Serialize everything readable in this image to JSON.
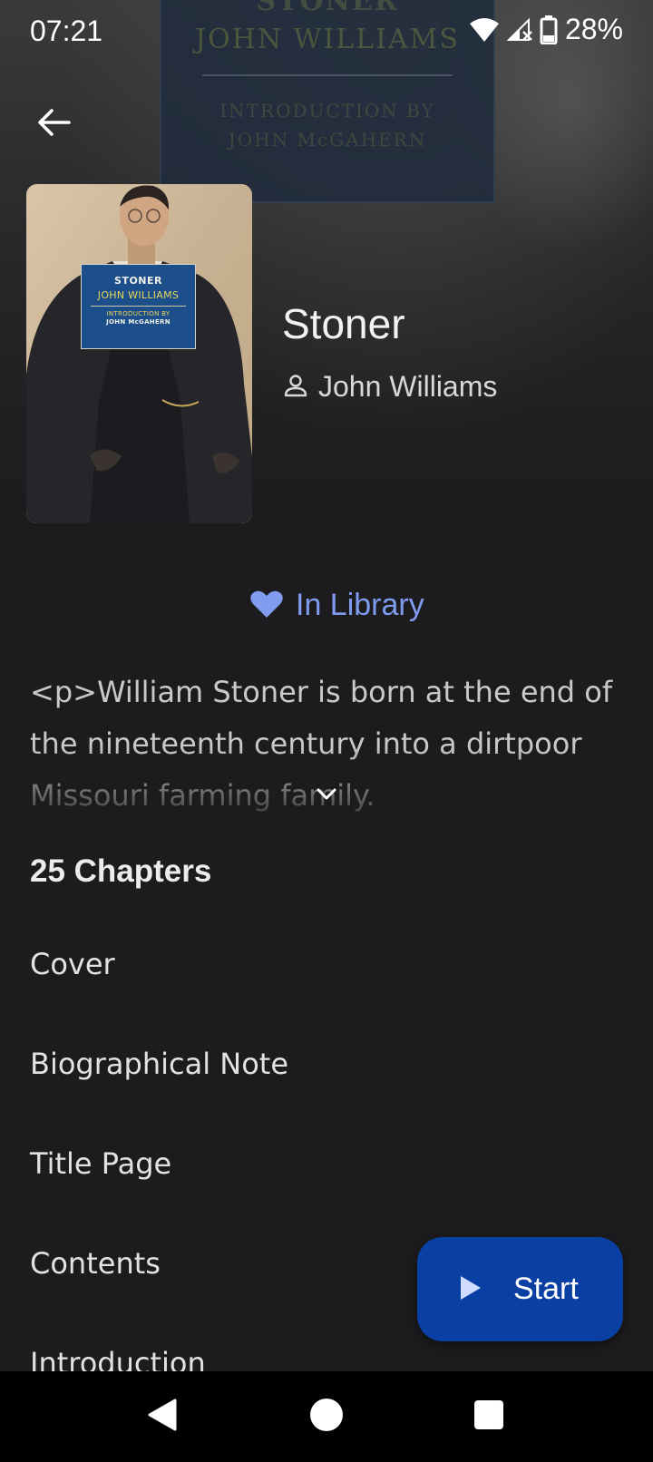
{
  "status_bar": {
    "time": "07:21",
    "battery": "28%",
    "icons": [
      "wifi-icon",
      "cellular-signal-icon",
      "battery-icon"
    ]
  },
  "header": {
    "back_icon": "arrow-left-icon"
  },
  "background_cover": {
    "title": "STONER",
    "author": "JOHN WILLIAMS",
    "intro_line1": "INTRODUCTION BY",
    "intro_line2": "JOHN McGAHERN"
  },
  "cover": {
    "title": "STONER",
    "author": "JOHN WILLIAMS",
    "intro_line1": "INTRODUCTION BY",
    "intro_line2": "JOHN McGAHERN"
  },
  "book": {
    "title": "Stoner",
    "author": "John Williams",
    "author_icon": "person-icon"
  },
  "library": {
    "label": "In Library",
    "icon": "heart-icon",
    "color": "#7f9cf0"
  },
  "description": {
    "text": "<p>William Stoner is born at the end of the nineteenth century into a dirtpoor Missouri farming family.",
    "expand_icon": "chevron-down-icon"
  },
  "chapters": {
    "heading": "25 Chapters",
    "items": [
      {
        "label": "Cover"
      },
      {
        "label": "Biographical Note"
      },
      {
        "label": "Title Page"
      },
      {
        "label": "Contents"
      },
      {
        "label": "Introduction"
      }
    ]
  },
  "fab": {
    "label": "Start",
    "icon": "play-icon",
    "color": "#0a3fa3"
  },
  "nav_bar": {
    "back_icon": "nav-back-icon",
    "home_icon": "nav-home-icon",
    "recents_icon": "nav-recents-icon"
  }
}
